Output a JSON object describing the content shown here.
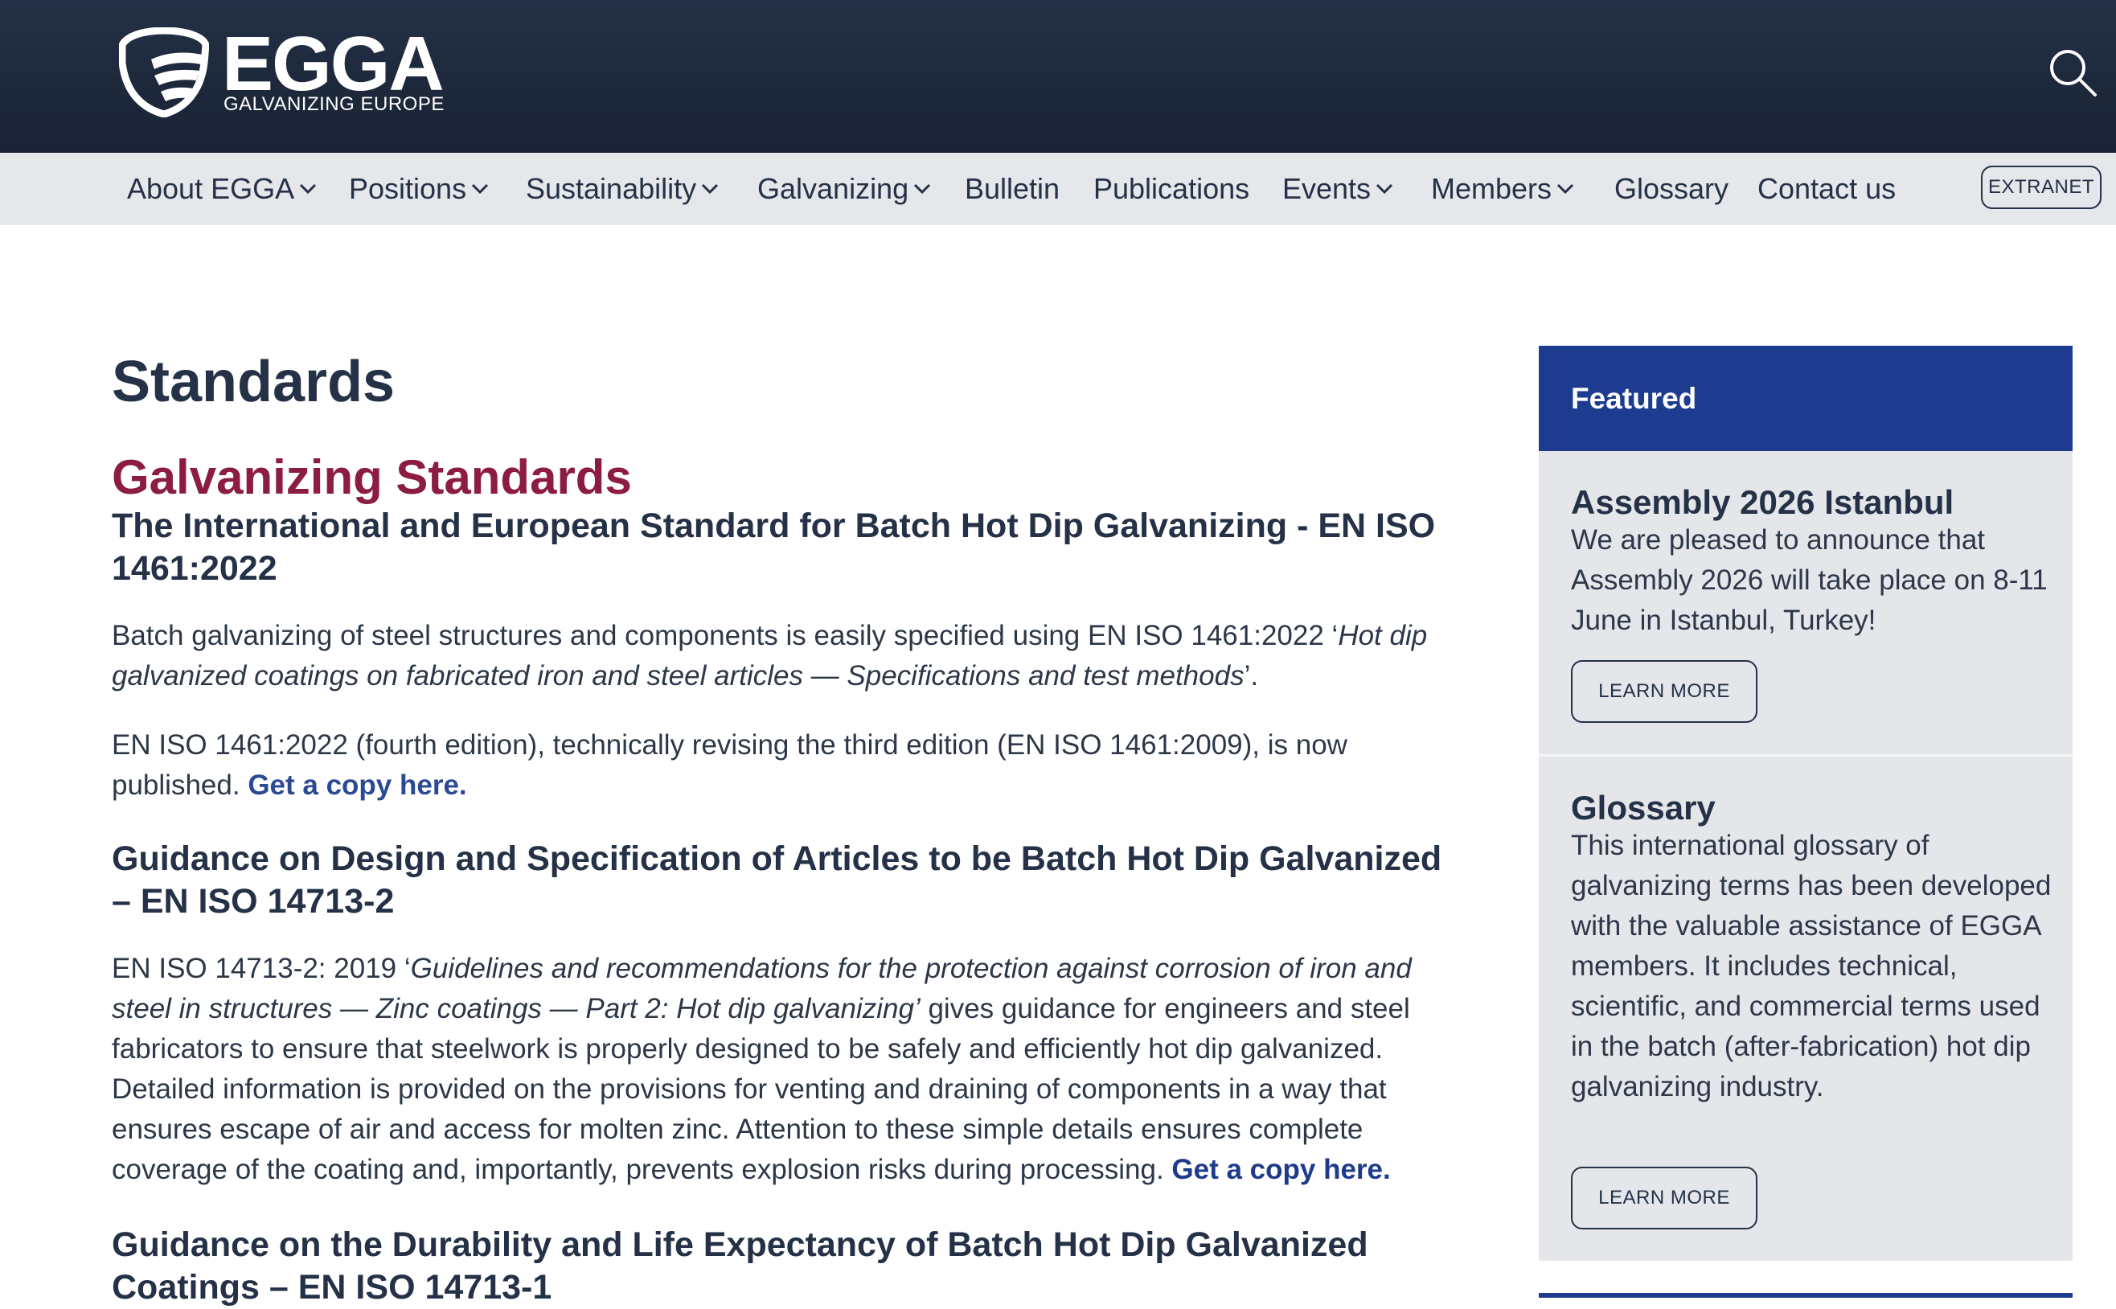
{
  "brand": {
    "name": "EGGA",
    "tagline": "GALVANIZING EUROPE"
  },
  "colors": {
    "header_bg": "#1d283b",
    "nav_bg": "#e6e7eb",
    "heading": "#243146",
    "accent": "#8c1d40",
    "featured_bg": "#1d3c8f",
    "link": "#2b4a94"
  },
  "nav": {
    "items": [
      {
        "label": "About EGGA",
        "dropdown": true
      },
      {
        "label": "Positions",
        "dropdown": true
      },
      {
        "label": "Sustainability",
        "dropdown": true
      },
      {
        "label": "Galvanizing",
        "dropdown": true
      },
      {
        "label": "Bulletin",
        "dropdown": false
      },
      {
        "label": "Publications",
        "dropdown": false
      },
      {
        "label": "Events",
        "dropdown": true
      },
      {
        "label": "Members",
        "dropdown": true
      },
      {
        "label": "Glossary",
        "dropdown": false
      },
      {
        "label": "Contact us",
        "dropdown": false
      }
    ],
    "extranet_label": "EXTRANET",
    "search_icon": "search-icon"
  },
  "main": {
    "title": "Standards",
    "section_title": "Galvanizing Standards",
    "s1": {
      "heading": "The International and European Standard for Batch Hot Dip Galvanizing - EN ISO 1461:2022",
      "p1_start": "Batch galvanizing of steel structures and components is easily specified using EN ISO 1461:2022 ‘",
      "p1_italic": "Hot dip galvanized coatings on fabricated iron and steel articles — Specifications and test methods",
      "p1_end": "’.",
      "p2_text": "EN ISO 1461:2022 (fourth edition), technically revising the third edition (EN ISO 1461:2009), is now published.",
      "p2_link": "Get a copy here."
    },
    "s2": {
      "heading": "Guidance on Design and Specification of Articles to be Batch Hot Dip Galvanized – EN ISO 14713-2",
      "p_start": "EN ISO 14713-2: 2019 ‘",
      "p_italic": "Guidelines and recommendations for the protection against corrosion of iron and steel in structures — Zinc coatings — Part 2: Hot dip galvanizing’",
      "p_end": " gives guidance for engineers and steel fabricators to ensure that steelwork is properly designed to be safely and efficiently hot dip galvanized. Detailed information is provided on the provisions for venting and draining of components in a way that ensures escape of air and access for molten zinc. Attention to these simple details ensures complete coverage of the coating and, importantly, prevents explosion risks during processing.",
      "p_link": "Get a copy here."
    },
    "s3": {
      "heading": "Guidance on the Durability and Life Expectancy of Batch Hot Dip Galvanized Coatings – EN ISO 14713-1"
    }
  },
  "sidebar": {
    "featured_label": "Featured",
    "cards": [
      {
        "title": "Assembly 2026 Istanbul",
        "text": "We are pleased to announce that Assembly 2026 will take place on 8-11 June in Istanbul, Turkey!",
        "button": "LEARN MORE"
      },
      {
        "title": "Glossary",
        "text": "This international glossary of galvanizing terms has been developed with the valuable assistance of EGGA members. It includes technical, scientific, and commercial terms used in the batch (after-fabrication) hot dip galvanizing industry.",
        "button": "LEARN MORE"
      }
    ]
  }
}
